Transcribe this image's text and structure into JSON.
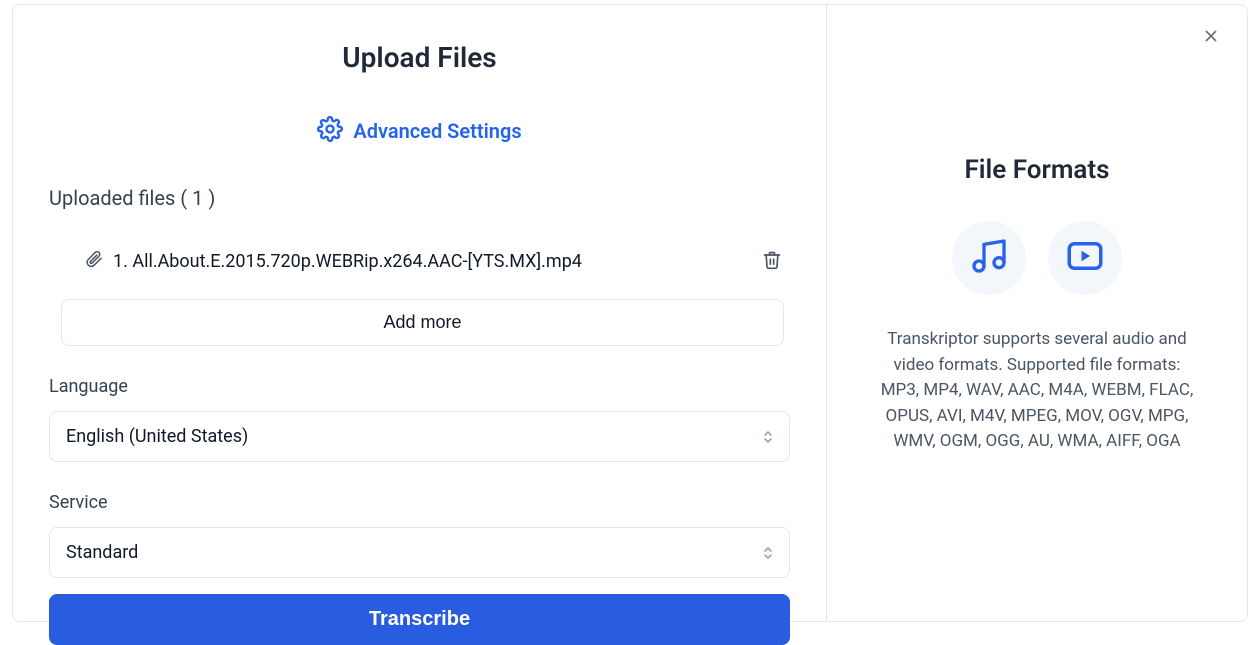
{
  "title": "Upload Files",
  "advanced_settings_label": "Advanced Settings",
  "uploaded_files_label": "Uploaded files ( 1 )",
  "files": [
    {
      "name": "1. All.About.E.2015.720p.WEBRip.x264.AAC-[YTS.MX].mp4"
    }
  ],
  "add_more_label": "Add more",
  "language_label": "Language",
  "language_value": "English (United States)",
  "service_label": "Service",
  "service_value": "Standard",
  "transcribe_label": "Transcribe",
  "right": {
    "title": "File Formats",
    "description": "Transkriptor supports several audio and video formats. Supported file formats: MP3, MP4, WAV, AAC, M4A, WEBM, FLAC, OPUS, AVI, M4V, MPEG, MOV, OGV, MPG, WMV, OGM, OGG, AU, WMA, AIFF, OGA"
  },
  "colors": {
    "accent": "#2563eb",
    "primary_button": "#2a5ce0"
  }
}
